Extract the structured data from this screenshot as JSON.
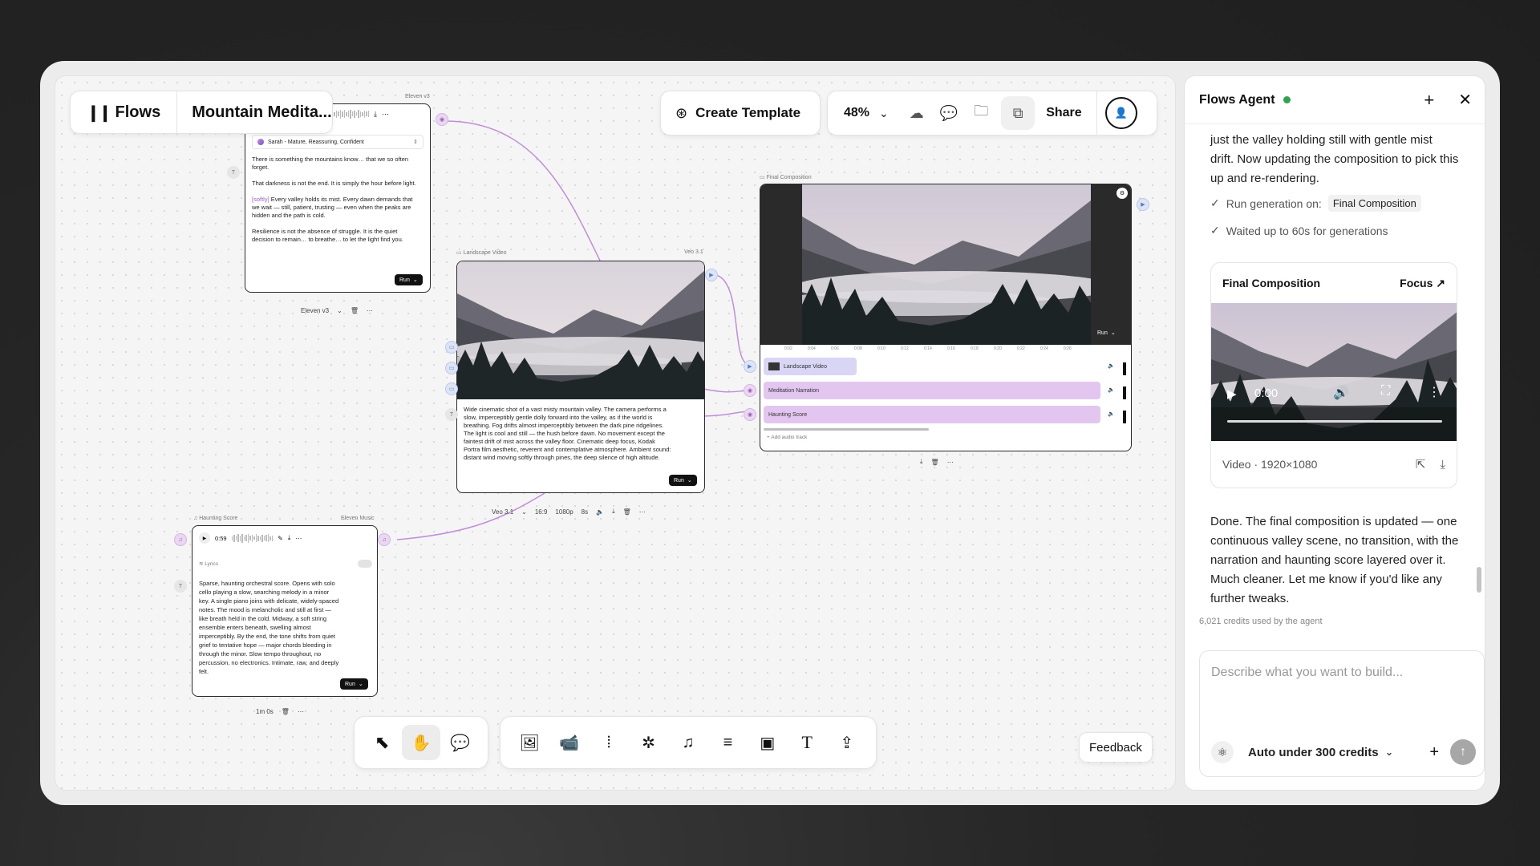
{
  "header": {
    "brand": "Flows",
    "project_title": "Mountain Medita...",
    "create_template": "Create Template",
    "zoom": "48%",
    "share": "Share"
  },
  "nodes": {
    "narration": {
      "model_label": "Eleven v3",
      "voice": "Sarah - Mature, Reassuring, Confident",
      "text_1": "There is something the mountains know… that we so often forget.",
      "text_2": "That darkness is not the end. It is simply the hour before light.",
      "tag": "[softly]",
      "text_3": " Every valley holds its mist. Every dawn demands that we wait — still, patient, trusting — even when the peaks are hidden and the path is cold.",
      "text_4": "Resilience is not the absence of struggle. It is the quiet decision to remain… to breathe… to let the light find you.",
      "run": "Run",
      "bottom_model": "Eleven v3"
    },
    "landscape": {
      "label": "Landscape Video",
      "model_label": "Veo 3.1",
      "prompt": "Wide cinematic shot of a vast misty mountain valley. The camera performs a slow, imperceptibly gentle dolly forward into the valley, as if the world is breathing. Fog drifts almost imperceptibly between the dark pine ridgelines. The light is cool and still — the hush before dawn. No movement except the faintest drift of mist across the valley floor. Cinematic deep focus, Kodak Portra film aesthetic, reverent and contemplative atmosphere. Ambient sound: distant wind moving softly through pines, the deep silence of high altitude.",
      "run": "Run",
      "bottom": [
        "Veo 3.1",
        "16:9",
        "1080p",
        "8s"
      ]
    },
    "final": {
      "label": "Final Composition",
      "run": "Run",
      "ticks": [
        "0:02",
        "0:04",
        "0:06",
        "0:08",
        "0:10",
        "0:12",
        "0:14",
        "0:16",
        "0:18",
        "0:20",
        "0:22",
        "0:24",
        "0:26"
      ],
      "tracks": [
        "Landscape Video",
        "Meditation Narration",
        "Haunting Score"
      ],
      "add_track": "+ Add audio track"
    },
    "score": {
      "label": "Haunting Score",
      "model_label": "Eleven Music",
      "time": "0:59",
      "lyrics": "Lyrics",
      "prompt": "Sparse, haunting orchestral score. Opens with solo cello playing a slow, searching melody in a minor key. A single piano joins with delicate, widely-spaced notes. The mood is melancholic and still at first — like breath held in the cold. Midway, a soft string ensemble enters beneath, swelling almost imperceptibly. By the end, the tone shifts from quiet grief to tentative hope — major chords bleeding in through the minor. Slow tempo throughout, no percussion, no electronics. Intimate, raw, and deeply felt.",
      "run": "Run",
      "duration": "1m 0s"
    }
  },
  "feedback": "Feedback",
  "agent": {
    "title": "Flows Agent",
    "status_color": "#2ea44f",
    "message_partial": "just the valley holding still with gentle mist drift. Now updating the composition to pick this up and re-rendering.",
    "step_1": "Run generation on:",
    "step_1_chip": "Final Composition",
    "step_2": "Waited up to 60s for generations",
    "card_title": "Final Composition",
    "focus": "Focus ↗",
    "player_time": "0:00",
    "card_meta": "Video · 1920×1080",
    "done_message": "Done. The final composition is updated — one continuous valley scene, no transition, with the narration and haunting score layered over it. Much cleaner. Let me know if you'd like any further tweaks.",
    "credits": "6,021 credits used by the agent",
    "input_placeholder": "Describe what you want to build...",
    "credit_mode": "Auto under 300 credits"
  },
  "colors": {
    "accent_purple": "#b77fd0",
    "track_purple": "#e3c6ef",
    "track_blue": "#d8d5f5"
  }
}
